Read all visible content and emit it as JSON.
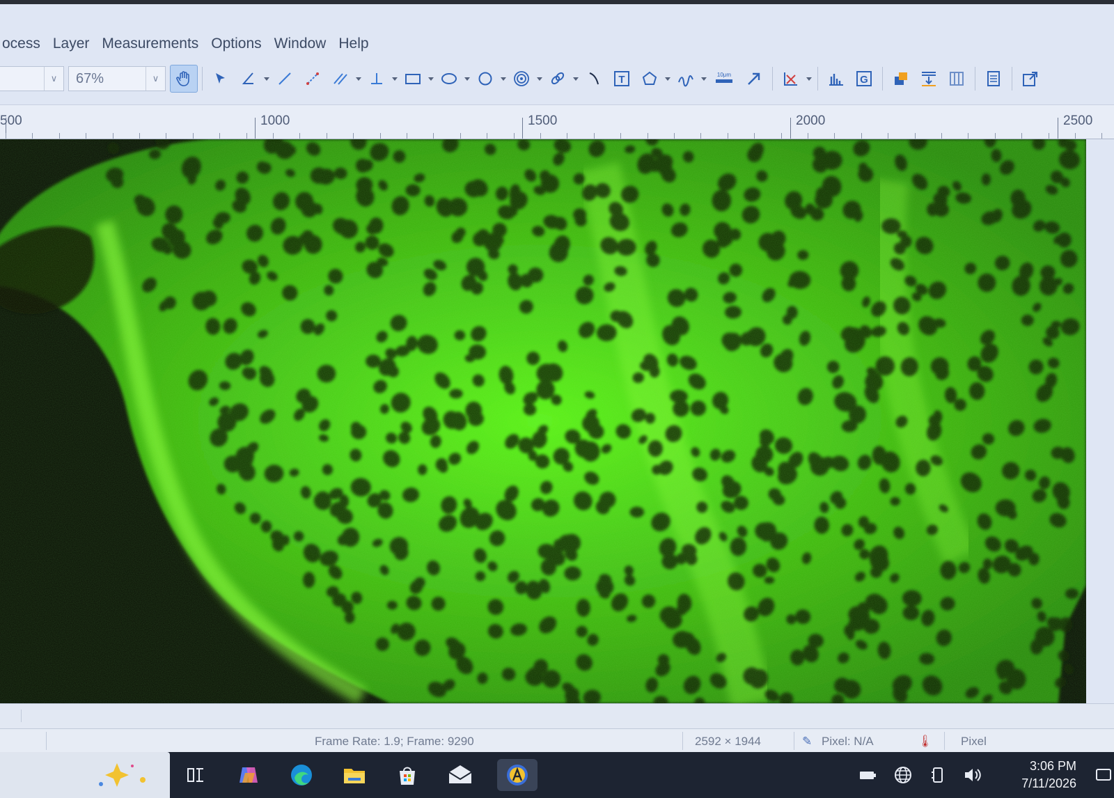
{
  "menu": [
    "ocess",
    "Layer",
    "Measurements",
    "Options",
    "Window",
    "Help"
  ],
  "toolbar": {
    "combo_left_value": "",
    "zoom_value": "67%",
    "tools": [
      {
        "name": "pan-hand-icon",
        "active": true
      },
      {
        "name": "select-arrow-icon"
      },
      {
        "name": "angle-icon",
        "dropdown": true
      },
      {
        "name": "line-icon"
      },
      {
        "name": "multi-point-line-icon"
      },
      {
        "name": "parallel-lines-icon",
        "dropdown": true
      },
      {
        "name": "perpendicular-icon",
        "dropdown": true
      },
      {
        "name": "rectangle-icon",
        "dropdown": true
      },
      {
        "name": "ellipse-icon",
        "dropdown": true
      },
      {
        "name": "circle-icon",
        "dropdown": true
      },
      {
        "name": "concentric-circles-icon",
        "dropdown": true
      },
      {
        "name": "link-chain-icon",
        "dropdown": true
      },
      {
        "name": "curve-icon"
      },
      {
        "name": "text-tool-icon"
      },
      {
        "name": "polygon-icon",
        "dropdown": true
      },
      {
        "name": "freehand-icon",
        "dropdown": true
      },
      {
        "name": "scale-bar-icon"
      },
      {
        "name": "arrow-icon"
      },
      {
        "name": "calibrate-icon",
        "dropdown": true
      },
      {
        "name": "histogram-icon"
      },
      {
        "name": "grid-g-icon"
      },
      {
        "name": "layers-icon"
      },
      {
        "name": "merge-down-icon"
      },
      {
        "name": "columns-icon"
      },
      {
        "name": "report-icon"
      },
      {
        "name": "export-icon"
      }
    ],
    "scale_bar_label": "10μm",
    "text_tool_label": "T",
    "grid_label": "G"
  },
  "ruler": {
    "labels": [
      {
        "text": "500",
        "pos": "a"
      },
      {
        "text": "1000",
        "pos": "b"
      },
      {
        "text": "1500",
        "pos": "c"
      },
      {
        "text": "2000",
        "pos": "d"
      },
      {
        "text": "2500",
        "pos": "e"
      }
    ]
  },
  "status": {
    "frame_info": "Frame Rate: 1.9; Frame: 9290",
    "dimensions": "2592 × 1944",
    "pixel_size": "Pixel: N/A",
    "unit": "Pixel"
  },
  "taskbar": {
    "time": "3:06 PM",
    "date": "7/11/2026"
  },
  "colors": {
    "fluorescence": "#5cf21a",
    "background": "#0a1006",
    "accent": "#2f6fd0"
  }
}
